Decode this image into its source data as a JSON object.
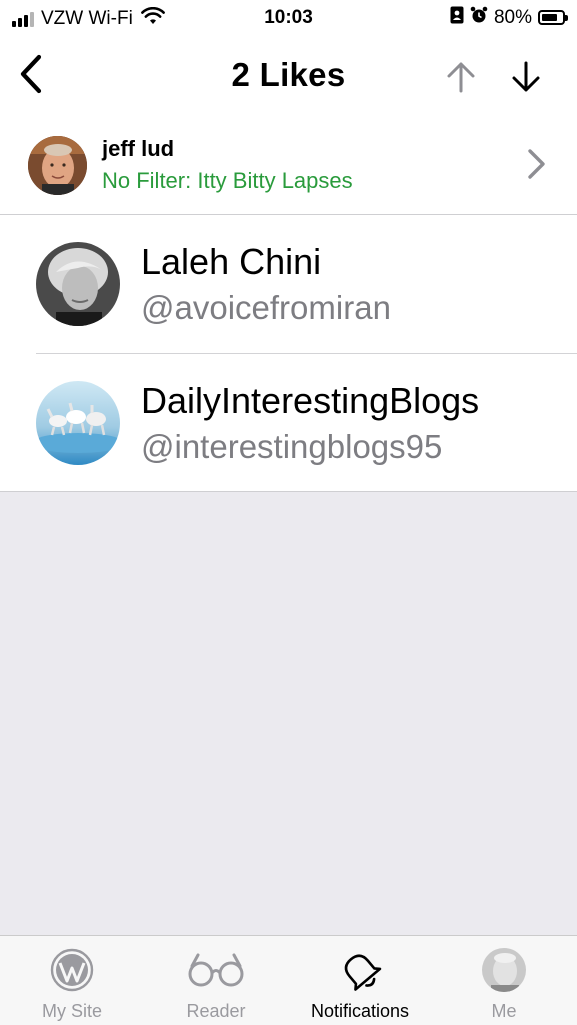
{
  "status_bar": {
    "carrier": "VZW Wi-Fi",
    "time": "10:03",
    "battery": "80%",
    "battery_level": 0.8,
    "signal_bars_active": 3,
    "signal_bars_total": 4
  },
  "nav": {
    "title": "2 Likes",
    "back_icon": "chevron-left-icon",
    "up_icon": "arrow-up-icon",
    "down_icon": "arrow-down-icon"
  },
  "post": {
    "author": "jeff lud",
    "title": "No Filter: Itty Bitty Lapses",
    "title_color": "#2a9b3c"
  },
  "likes": [
    {
      "name": "Laleh Chini",
      "handle": "@avoicefromiran"
    },
    {
      "name": "DailyInterestingBlogs",
      "handle": "@interestingblogs95"
    }
  ],
  "tab_bar": {
    "tabs": [
      {
        "label": "My Site",
        "icon": "wordpress-icon",
        "active": false
      },
      {
        "label": "Reader",
        "icon": "glasses-icon",
        "active": false
      },
      {
        "label": "Notifications",
        "icon": "bell-icon",
        "active": true
      },
      {
        "label": "Me",
        "icon": "avatar-icon",
        "active": false
      }
    ]
  },
  "colors": {
    "accent_green": "#2a9b3c",
    "handle_gray": "#7d7d82",
    "background_gray": "#ebeaef",
    "inactive_tab": "#9a9a9f"
  }
}
